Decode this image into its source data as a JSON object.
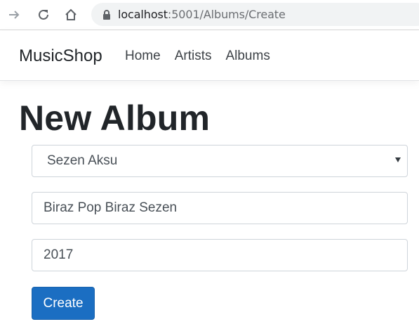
{
  "browser": {
    "url_host": "localhost",
    "url_path": ":5001/Albums/Create"
  },
  "navbar": {
    "brand": "MusicShop",
    "links": [
      "Home",
      "Artists",
      "Albums"
    ]
  },
  "page": {
    "title": "New Album"
  },
  "form": {
    "artist_selected": "Sezen Aksu",
    "album_title_value": "Biraz Pop Biraz Sezen",
    "year_value": "2017",
    "submit_label": "Create"
  },
  "colors": {
    "primary_button": "#1b6ec2",
    "url_bar": "#f1f3f4"
  }
}
